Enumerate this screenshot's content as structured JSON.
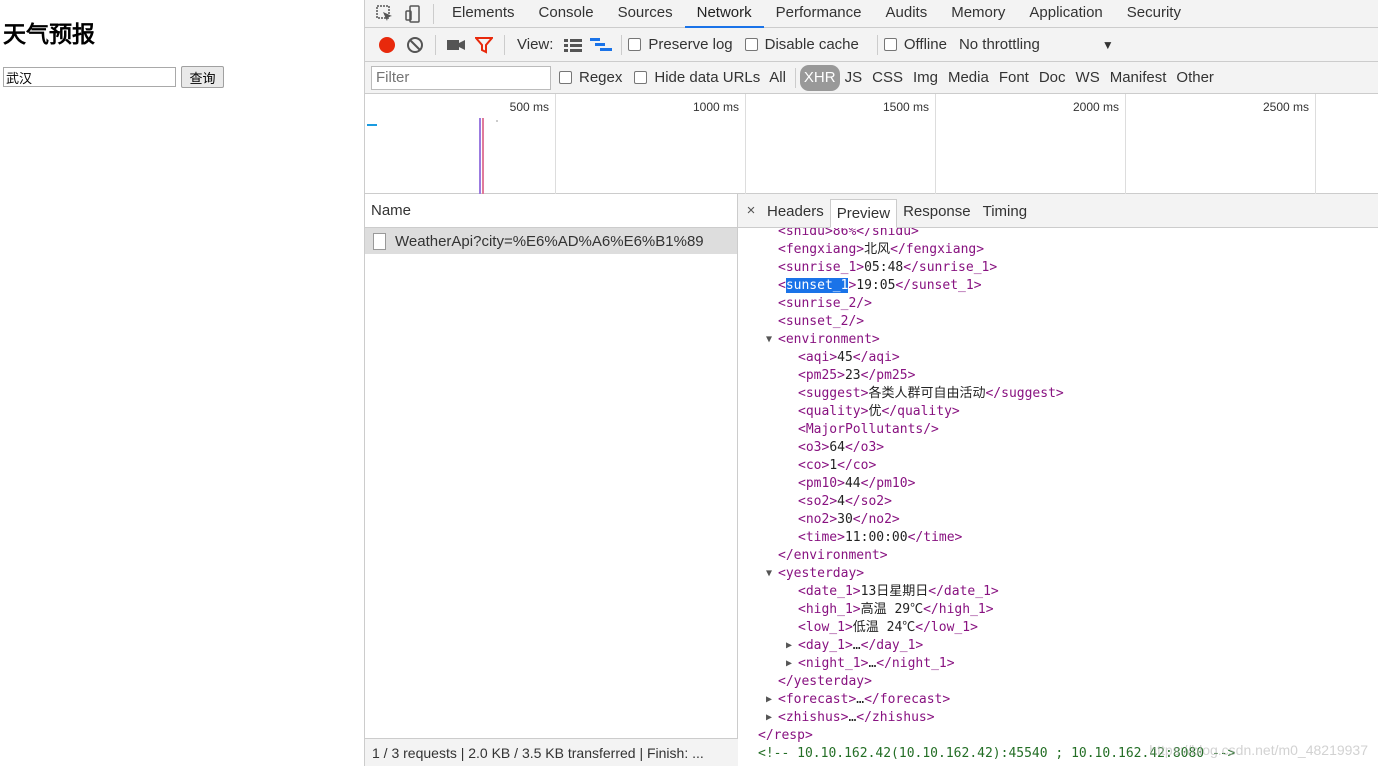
{
  "page": {
    "title": "天气预报",
    "city_value": "武汉",
    "query_label": "查询"
  },
  "devtools": {
    "tabs": [
      "Elements",
      "Console",
      "Sources",
      "Network",
      "Performance",
      "Audits",
      "Memory",
      "Application",
      "Security"
    ],
    "active_tab": "Network",
    "toolbar": {
      "view_label": "View:",
      "preserve_log": "Preserve log",
      "disable_cache": "Disable cache",
      "offline": "Offline",
      "throttling": "No throttling"
    },
    "filter": {
      "placeholder": "Filter",
      "regex": "Regex",
      "hide_data_urls": "Hide data URLs",
      "types": [
        "All",
        "XHR",
        "JS",
        "CSS",
        "Img",
        "Media",
        "Font",
        "Doc",
        "WS",
        "Manifest",
        "Other"
      ],
      "active_type": "XHR"
    },
    "overview": {
      "ticks": [
        "500 ms",
        "1000 ms",
        "1500 ms",
        "2000 ms",
        "2500 ms"
      ]
    },
    "requests": {
      "name_header": "Name",
      "rows": [
        "WeatherApi?city=%E6%AD%A6%E6%B1%89"
      ],
      "status": "1 / 3 requests  |  2.0 KB / 3.5 KB transferred  |  Finish: ..."
    },
    "detail": {
      "close": "×",
      "tabs": [
        "Headers",
        "Preview",
        "Response",
        "Timing"
      ],
      "active_tab": "Preview",
      "xml_lines": [
        {
          "indent": 1,
          "text": "<shidu>86%</shidu>"
        },
        {
          "indent": 1,
          "open": "fengxiang",
          "value": "北风"
        },
        {
          "indent": 1,
          "open": "sunrise_1",
          "value": "05:48"
        },
        {
          "indent": 1,
          "open": "sunset_1",
          "value": "19:05",
          "selected": true
        },
        {
          "indent": 1,
          "empty": "sunrise_2"
        },
        {
          "indent": 1,
          "empty": "sunset_2"
        },
        {
          "indent": 1,
          "start": "environment",
          "expanded": true
        },
        {
          "indent": 2,
          "open": "aqi",
          "value": "45"
        },
        {
          "indent": 2,
          "open": "pm25",
          "value": "23"
        },
        {
          "indent": 2,
          "open": "suggest",
          "value": "各类人群可自由活动"
        },
        {
          "indent": 2,
          "open": "quality",
          "value": "优"
        },
        {
          "indent": 2,
          "empty": "MajorPollutants"
        },
        {
          "indent": 2,
          "open": "o3",
          "value": "64"
        },
        {
          "indent": 2,
          "open": "co",
          "value": "1"
        },
        {
          "indent": 2,
          "open": "pm10",
          "value": "44"
        },
        {
          "indent": 2,
          "open": "so2",
          "value": "4"
        },
        {
          "indent": 2,
          "open": "no2",
          "value": "30"
        },
        {
          "indent": 2,
          "open": "time",
          "value": "11:00:00"
        },
        {
          "indent": 1,
          "end": "environment"
        },
        {
          "indent": 1,
          "start": "yesterday",
          "expanded": true
        },
        {
          "indent": 2,
          "open": "date_1",
          "value": "13日星期日"
        },
        {
          "indent": 2,
          "open": "high_1",
          "value": "高温 29℃"
        },
        {
          "indent": 2,
          "open": "low_1",
          "value": "低温 24℃"
        },
        {
          "indent": 2,
          "collapsed": "day_1"
        },
        {
          "indent": 2,
          "collapsed": "night_1"
        },
        {
          "indent": 1,
          "end": "yesterday"
        },
        {
          "indent": 1,
          "collapsed": "forecast"
        },
        {
          "indent": 1,
          "collapsed": "zhishus"
        },
        {
          "indent": 0,
          "end": "resp"
        },
        {
          "indent": 0,
          "comment": "<!-- 10.10.162.42(10.10.162.42):45540 ; 10.10.162.42:8080 -->"
        }
      ]
    },
    "watermark": "https://blog.csdn.net/m0_48219937"
  },
  "colors": {
    "tag": "#881280",
    "accent": "#1a73e8",
    "record": "#e8290c",
    "comment": "#236e25"
  }
}
